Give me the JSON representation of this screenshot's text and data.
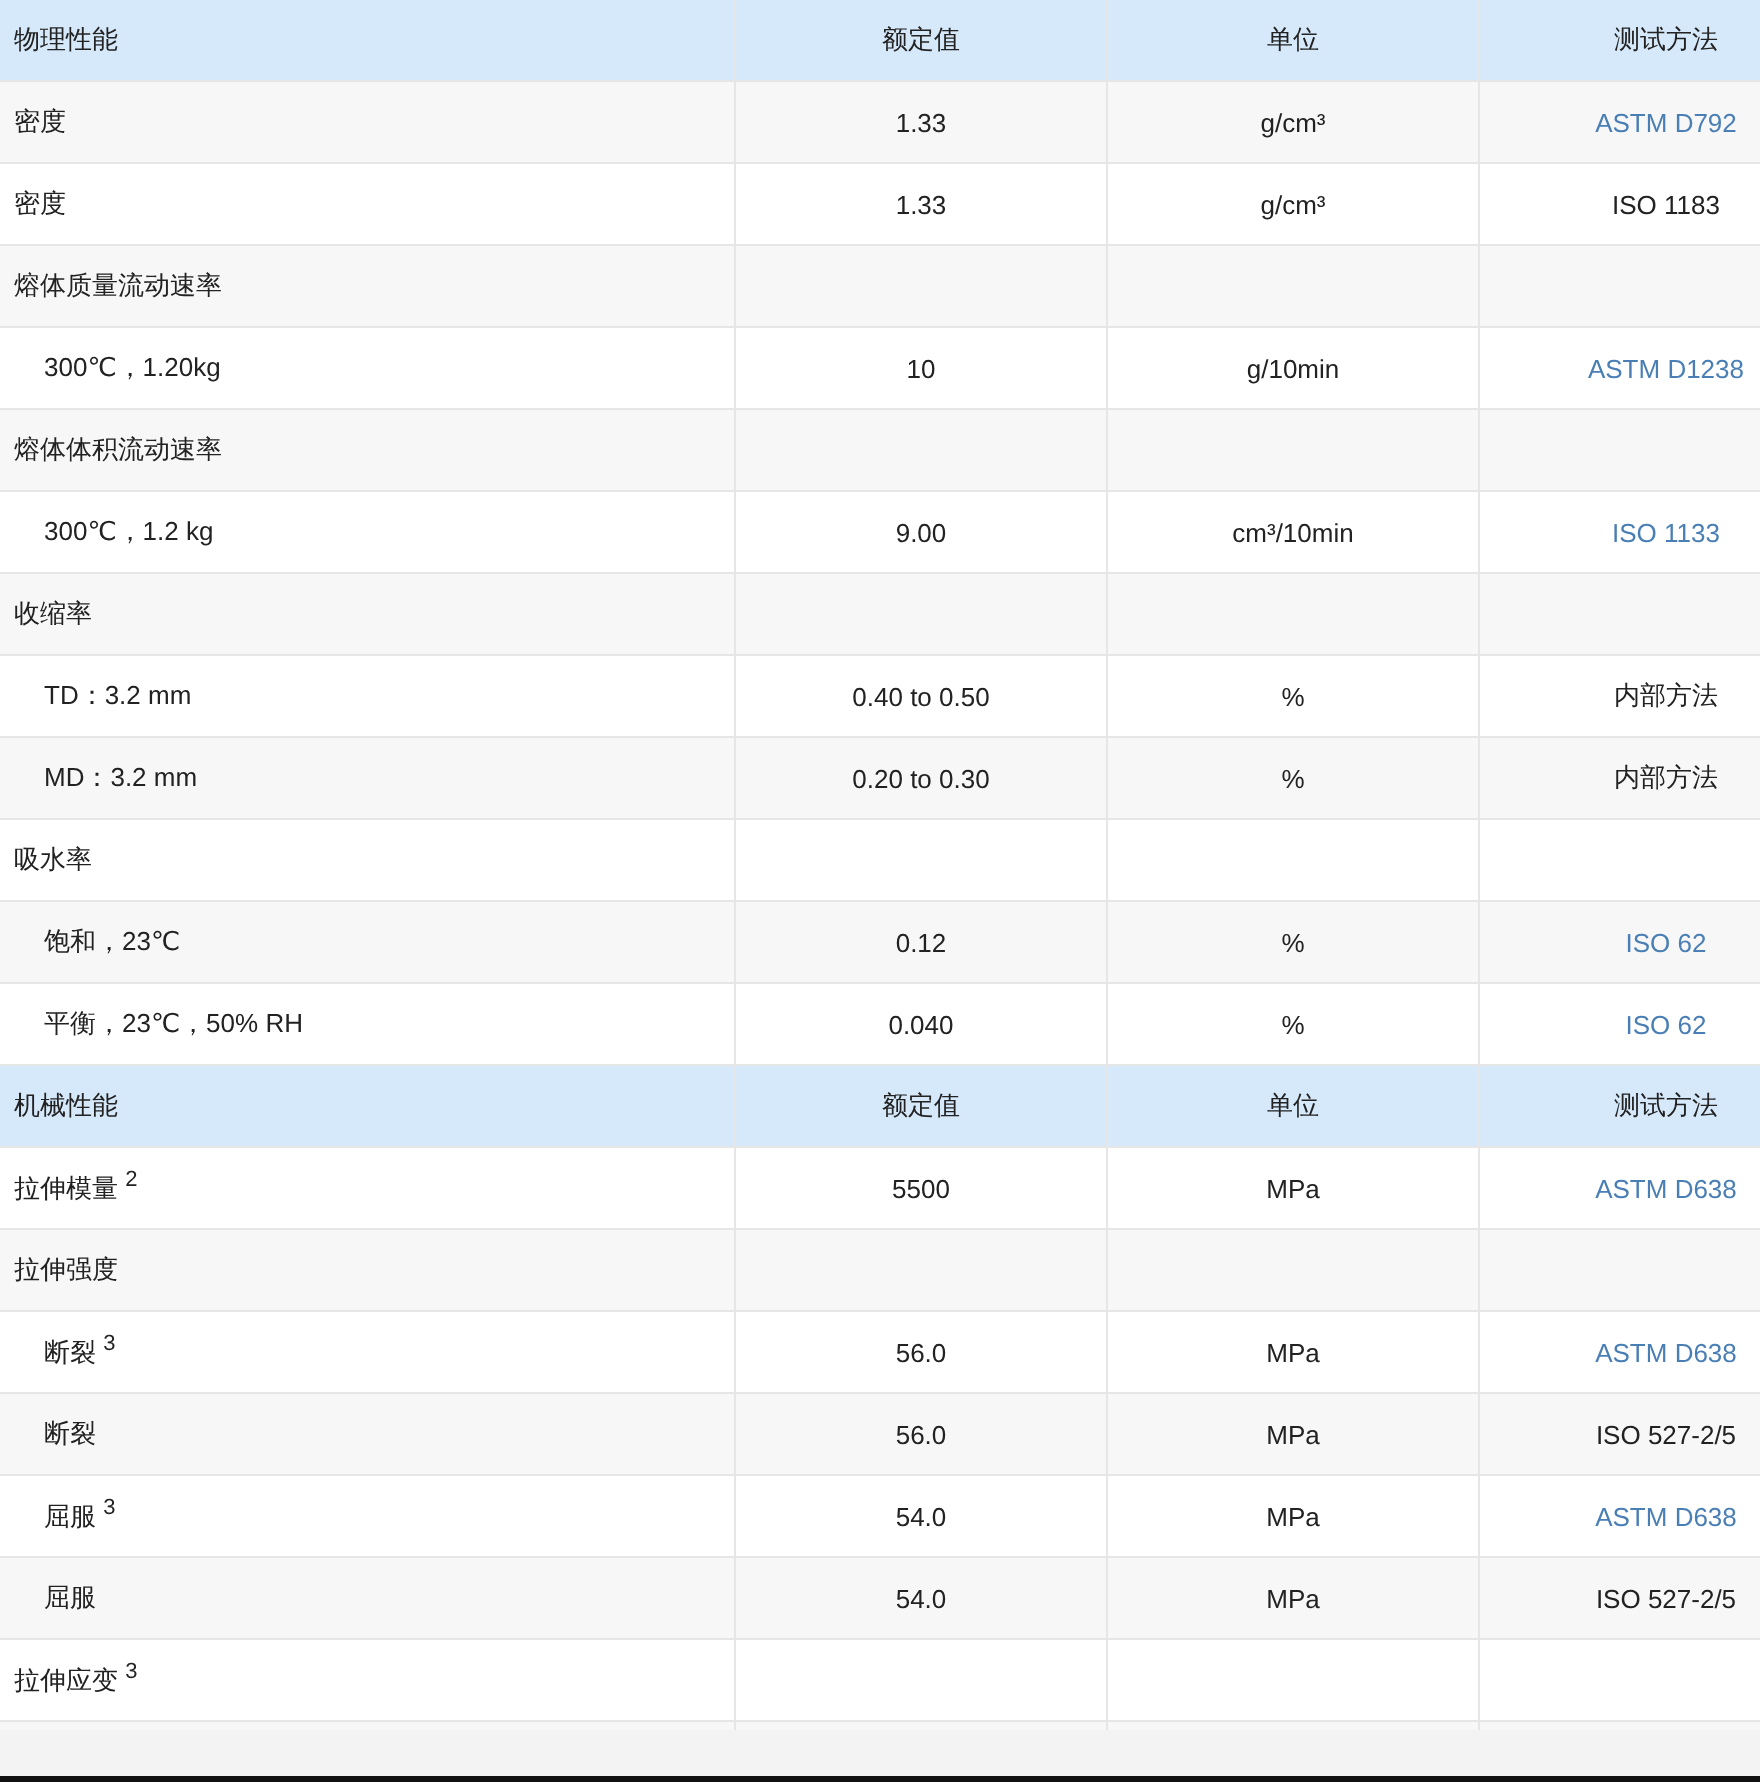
{
  "sections": [
    {
      "columns": [
        "物理性能",
        "额定值",
        "单位",
        "测试方法"
      ],
      "rows": [
        {
          "label": "密度",
          "value": "1.33",
          "unit": "g/cm³",
          "method": {
            "text": "ASTM D792",
            "kind": "link"
          }
        },
        {
          "label": "密度",
          "value": "1.33",
          "unit": "g/cm³",
          "method": {
            "text": "ISO 1183",
            "kind": "plain"
          }
        },
        {
          "label": "熔体质量流动速率",
          "children": [
            {
              "label": "300℃，1.20kg",
              "value": "10",
              "unit": "g/10min",
              "method": {
                "text": "ASTM D1238",
                "kind": "link"
              }
            }
          ]
        },
        {
          "label": "熔体体积流动速率",
          "children": [
            {
              "label": "300℃，1.2 kg",
              "value": "9.00",
              "unit": "cm³/10min",
              "method": {
                "text": "ISO 1133",
                "kind": "link"
              }
            }
          ]
        },
        {
          "label": "收缩率",
          "children": [
            {
              "label": "TD：3.2 mm",
              "value": "0.40 to 0.50",
              "unit": "%",
              "method": {
                "text": "内部方法",
                "kind": "plain"
              }
            },
            {
              "label": "MD：3.2 mm",
              "value": "0.20 to 0.30",
              "unit": "%",
              "method": {
                "text": "内部方法",
                "kind": "plain"
              }
            }
          ]
        },
        {
          "label": "吸水率",
          "children": [
            {
              "label": "饱和，23℃",
              "value": "0.12",
              "unit": "%",
              "method": {
                "text": "ISO 62",
                "kind": "link"
              }
            },
            {
              "label": "平衡，23℃，50% RH",
              "value": "0.040",
              "unit": "%",
              "method": {
                "text": "ISO 62",
                "kind": "link"
              }
            }
          ]
        }
      ]
    },
    {
      "columns": [
        "机械性能",
        "额定值",
        "单位",
        "测试方法"
      ],
      "rows": [
        {
          "label": "拉伸模量 $^{2}$",
          "value": "5500",
          "unit": "MPa",
          "method": {
            "text": "ASTM D638",
            "kind": "link"
          }
        },
        {
          "label": "拉伸强度",
          "children": [
            {
              "label": "断裂 $^{3}$",
              "value": "56.0",
              "unit": "MPa",
              "method": {
                "text": "ASTM D638",
                "kind": "link"
              }
            },
            {
              "label": "断裂",
              "value": "56.0",
              "unit": "MPa",
              "method": {
                "text": "ISO 527-2/5",
                "kind": "plain"
              }
            },
            {
              "label": "屈服 $^{3}$",
              "value": "54.0",
              "unit": "MPa",
              "method": {
                "text": "ASTM D638",
                "kind": "link"
              }
            },
            {
              "label": "屈服",
              "value": "54.0",
              "unit": "MPa",
              "method": {
                "text": "ISO 527-2/5",
                "kind": "plain"
              }
            }
          ]
        },
        {
          "label": "拉伸应变 $^{3}$"
        }
      ]
    }
  ]
}
